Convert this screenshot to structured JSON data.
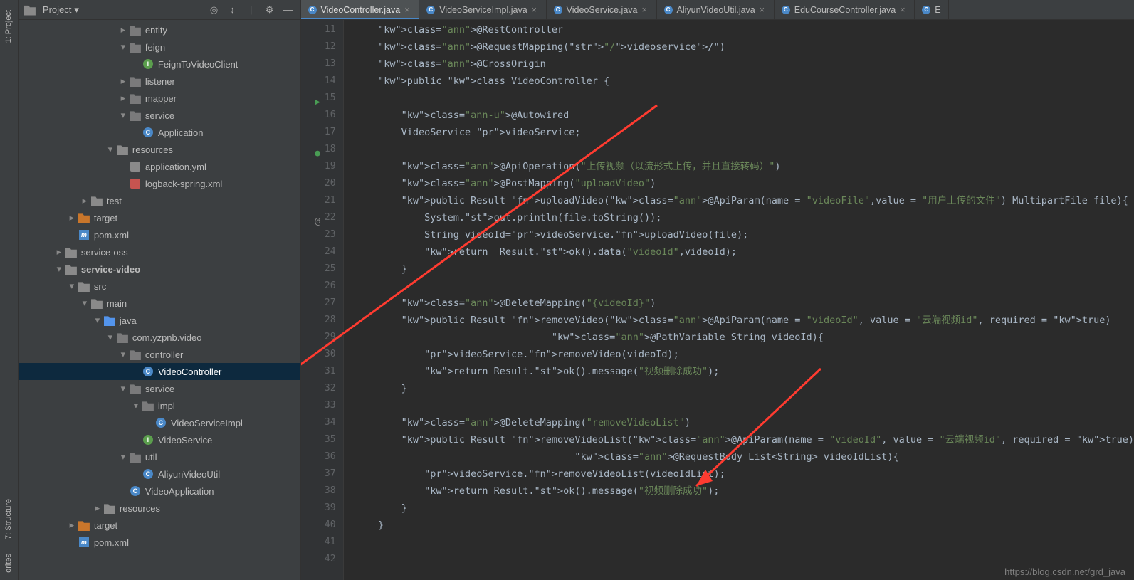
{
  "leftRail": {
    "project": "1: Project",
    "structure": "7: Structure",
    "favorites": "orites"
  },
  "header": {
    "title": "Project"
  },
  "tabs": [
    {
      "label": "VideoController.java",
      "active": true
    },
    {
      "label": "VideoServiceImpl.java",
      "active": false
    },
    {
      "label": "VideoService.java",
      "active": false
    },
    {
      "label": "AliyunVideoUtil.java",
      "active": false
    },
    {
      "label": "EduCourseController.java",
      "active": false
    },
    {
      "label": "E",
      "active": false,
      "truncated": true
    }
  ],
  "tree": [
    {
      "d": 7,
      "tw": "r",
      "i": "pkg",
      "t": "entity"
    },
    {
      "d": 7,
      "tw": "d",
      "i": "pkg",
      "t": "feign"
    },
    {
      "d": 8,
      "tw": "",
      "i": "iface",
      "t": "FeignToVideoClient"
    },
    {
      "d": 7,
      "tw": "r",
      "i": "pkg",
      "t": "listener"
    },
    {
      "d": 7,
      "tw": "r",
      "i": "pkg",
      "t": "mapper"
    },
    {
      "d": 7,
      "tw": "d",
      "i": "pkg",
      "t": "service"
    },
    {
      "d": 8,
      "tw": "",
      "i": "class",
      "t": "Application"
    },
    {
      "d": 6,
      "tw": "d",
      "i": "folder",
      "t": "resources"
    },
    {
      "d": 7,
      "tw": "",
      "i": "yml",
      "t": "application.yml"
    },
    {
      "d": 7,
      "tw": "",
      "i": "xml",
      "t": "logback-spring.xml"
    },
    {
      "d": 4,
      "tw": "r",
      "i": "folder",
      "t": "test"
    },
    {
      "d": 3,
      "tw": "r",
      "i": "folder-orange",
      "t": "target"
    },
    {
      "d": 3,
      "tw": "",
      "i": "m",
      "t": "pom.xml"
    },
    {
      "d": 2,
      "tw": "r",
      "i": "folder",
      "t": "service-oss"
    },
    {
      "d": 2,
      "tw": "d",
      "i": "folder",
      "t": "service-video",
      "bold": true
    },
    {
      "d": 3,
      "tw": "d",
      "i": "folder",
      "t": "src"
    },
    {
      "d": 4,
      "tw": "d",
      "i": "folder",
      "t": "main"
    },
    {
      "d": 5,
      "tw": "d",
      "i": "folder-blue",
      "t": "java"
    },
    {
      "d": 6,
      "tw": "d",
      "i": "pkg",
      "t": "com.yzpnb.video"
    },
    {
      "d": 7,
      "tw": "d",
      "i": "pkg",
      "t": "controller"
    },
    {
      "d": 8,
      "tw": "",
      "i": "class",
      "t": "VideoController",
      "sel": true
    },
    {
      "d": 7,
      "tw": "d",
      "i": "pkg",
      "t": "service"
    },
    {
      "d": 8,
      "tw": "d",
      "i": "pkg",
      "t": "impl"
    },
    {
      "d": 9,
      "tw": "",
      "i": "class",
      "t": "VideoServiceImpl"
    },
    {
      "d": 8,
      "tw": "",
      "i": "iface",
      "t": "VideoService"
    },
    {
      "d": 7,
      "tw": "d",
      "i": "pkg",
      "t": "util"
    },
    {
      "d": 8,
      "tw": "",
      "i": "class",
      "t": "AliyunVideoUtil"
    },
    {
      "d": 7,
      "tw": "",
      "i": "class",
      "t": "VideoApplication"
    },
    {
      "d": 5,
      "tw": "r",
      "i": "folder",
      "t": "resources"
    },
    {
      "d": 3,
      "tw": "r",
      "i": "folder-orange",
      "t": "target"
    },
    {
      "d": 3,
      "tw": "",
      "i": "m",
      "t": "pom.xml"
    }
  ],
  "gutter": {
    "start": 11,
    "end": 42,
    "markers": {
      "15": "run",
      "18": "bean",
      "22": "at"
    }
  },
  "code": [
    "    @RestController",
    "    @RequestMapping(\"/videoservice/\")",
    "    @CrossOrigin",
    "    public class VideoController {",
    "",
    "        @Autowired",
    "        VideoService videoService;",
    "",
    "        @ApiOperation(\"上传视频（以流形式上传，并且直接转码）\")",
    "        @PostMapping(\"uploadVideo\")",
    "        public Result uploadVideo(@ApiParam(name = \"videoFile\",value = \"用户上传的文件\") MultipartFile file){",
    "            System.out.println(file.toString());",
    "            String videoId=videoService.uploadVideo(file);",
    "            return  Result.ok().data(\"videoId\",videoId);",
    "        }",
    "",
    "        @DeleteMapping(\"{videoId}\")",
    "        public Result removeVideo(@ApiParam(name = \"videoId\", value = \"云端视频id\", required = true)",
    "                                  @PathVariable String videoId){",
    "            videoService.removeVideo(videoId);",
    "            return Result.ok().message(\"视频删除成功\");",
    "        }",
    "",
    "        @DeleteMapping(\"removeVideoList\")",
    "        public Result removeVideoList(@ApiParam(name = \"videoId\", value = \"云端视频id\", required = true)",
    "                                      @RequestBody List<String> videoIdList){",
    "            videoService.removeVideoList(videoIdList);",
    "            return Result.ok().message(\"视频删除成功\");",
    "        }",
    "    }",
    ""
  ],
  "footerUrl": "https://blog.csdn.net/grd_java"
}
